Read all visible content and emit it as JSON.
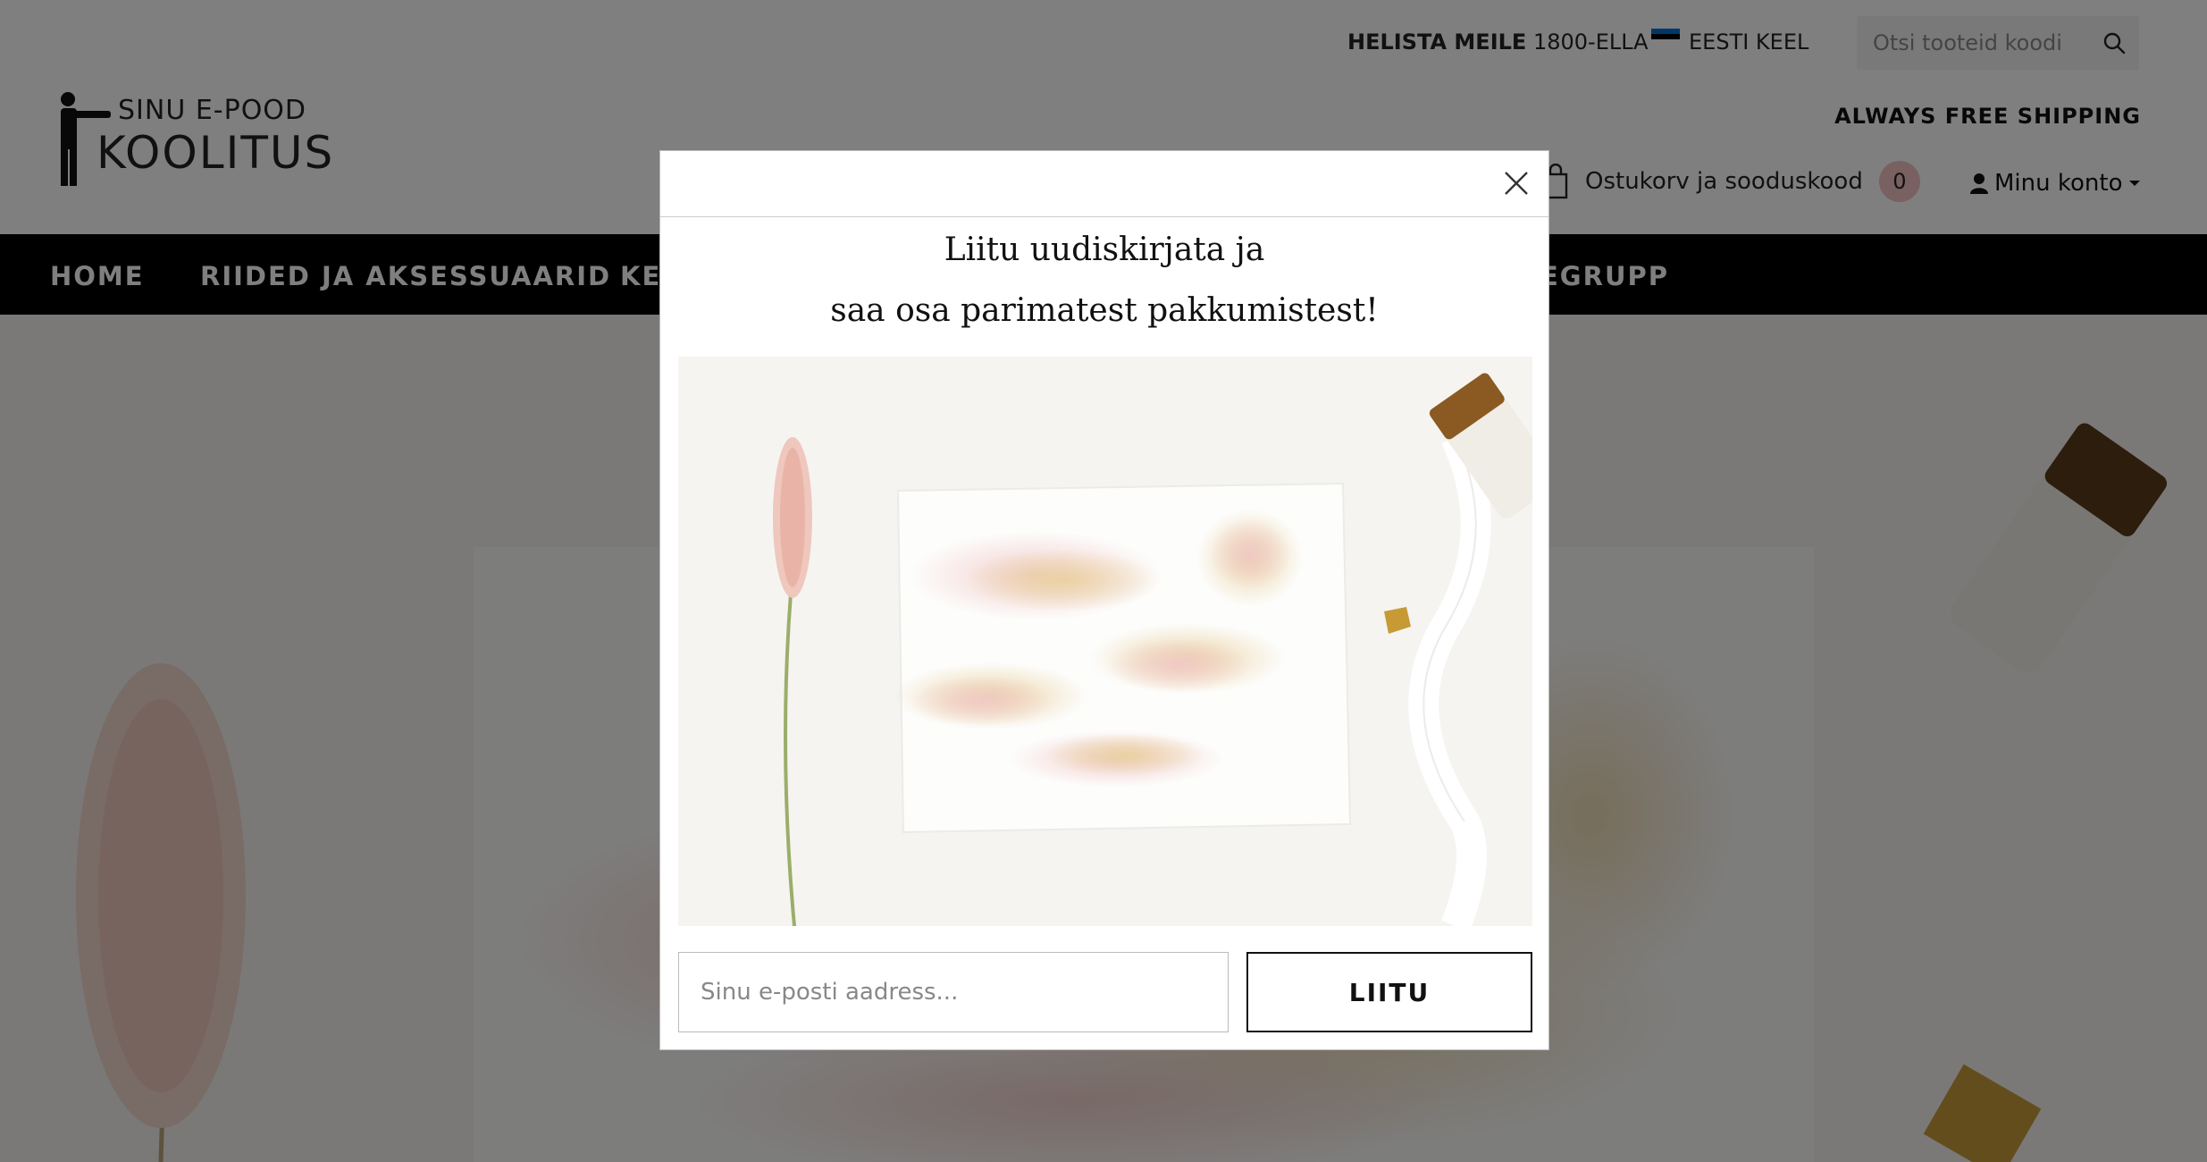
{
  "brand": {
    "logo_line1": "SINU E-POOD",
    "logo_line2": "KOOLITUS"
  },
  "topbar": {
    "phone_label": "HELISTA MEILE",
    "phone_number": "1800-ELLA",
    "language": "EESTI KEEL",
    "search_placeholder": "Otsi tooteid koodi",
    "free_shipping": "ALWAYS FREE SHIPPING"
  },
  "cart": {
    "label": "Ostukorv ja sooduskood",
    "count": "0",
    "count_color": "#f2c2c2"
  },
  "account": {
    "label": "Minu konto"
  },
  "nav": {
    "items": [
      {
        "label": "HOME"
      },
      {
        "label": "RIIDED JA AKSESSUAARID"
      },
      {
        "label": "KE"
      },
      {
        "label": "EGRUPP"
      }
    ]
  },
  "modal": {
    "title_line1": "Liitu uudiskirjata ja",
    "title_line2": "saa osa parimatest pakkumistest!",
    "email_placeholder": "Sinu e-posti aadress...",
    "submit_label": "LIITU"
  },
  "icons": {
    "search": "search-icon",
    "cart": "bag-icon",
    "account": "user-icon",
    "close": "close-icon",
    "flag": "estonia-flag-icon"
  },
  "colors": {
    "nav_background": "#000000",
    "overlay": "rgba(0,0,0,0.5)",
    "flag": [
      "#0072ce",
      "#000000",
      "#ffffff"
    ]
  }
}
